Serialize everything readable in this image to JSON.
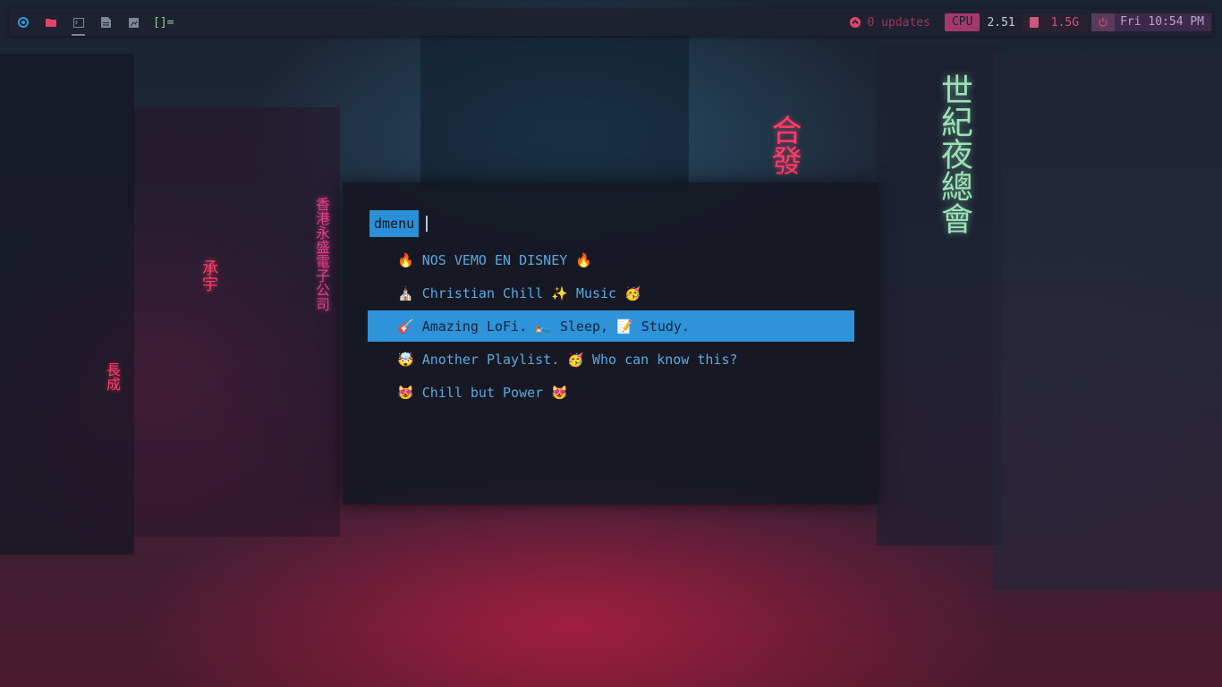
{
  "topbar": {
    "workspaces": [
      {
        "icon": "browser-icon",
        "color": "#2f9ad8"
      },
      {
        "icon": "folder-icon",
        "color": "#e0446a"
      },
      {
        "icon": "terminal-icon",
        "color": "#7c8599",
        "active": true
      },
      {
        "icon": "document-icon",
        "color": "#7c8599"
      },
      {
        "icon": "image-icon",
        "color": "#7c8599"
      }
    ],
    "layout": "[]=",
    "updates": "0 updates",
    "cpu_label": "CPU",
    "cpu_value": "2.51",
    "memory": "1.5G",
    "clock": "Fri 10:54 PM"
  },
  "wallpaper": {
    "neon_left": "香港永盛電子公司",
    "neon_right": "世紀夜總會",
    "neon_center": "合發",
    "neon_small": "承宇",
    "neon_shop": "長成"
  },
  "dmenu": {
    "prompt": "dmenu",
    "input": "",
    "selected_index": 2,
    "items": [
      {
        "text": "🔥 NOS VEMO EN DISNEY 🔥"
      },
      {
        "text": "⛪ Christian Chill ✨ Music 🥳"
      },
      {
        "text": "🎸 Amazing LoFi. 🛌 Sleep, 📝 Study."
      },
      {
        "text": "🤯 Another Playlist. 🥳 Who can know this?"
      },
      {
        "text": "😻 Chill but Power 😻"
      }
    ]
  }
}
